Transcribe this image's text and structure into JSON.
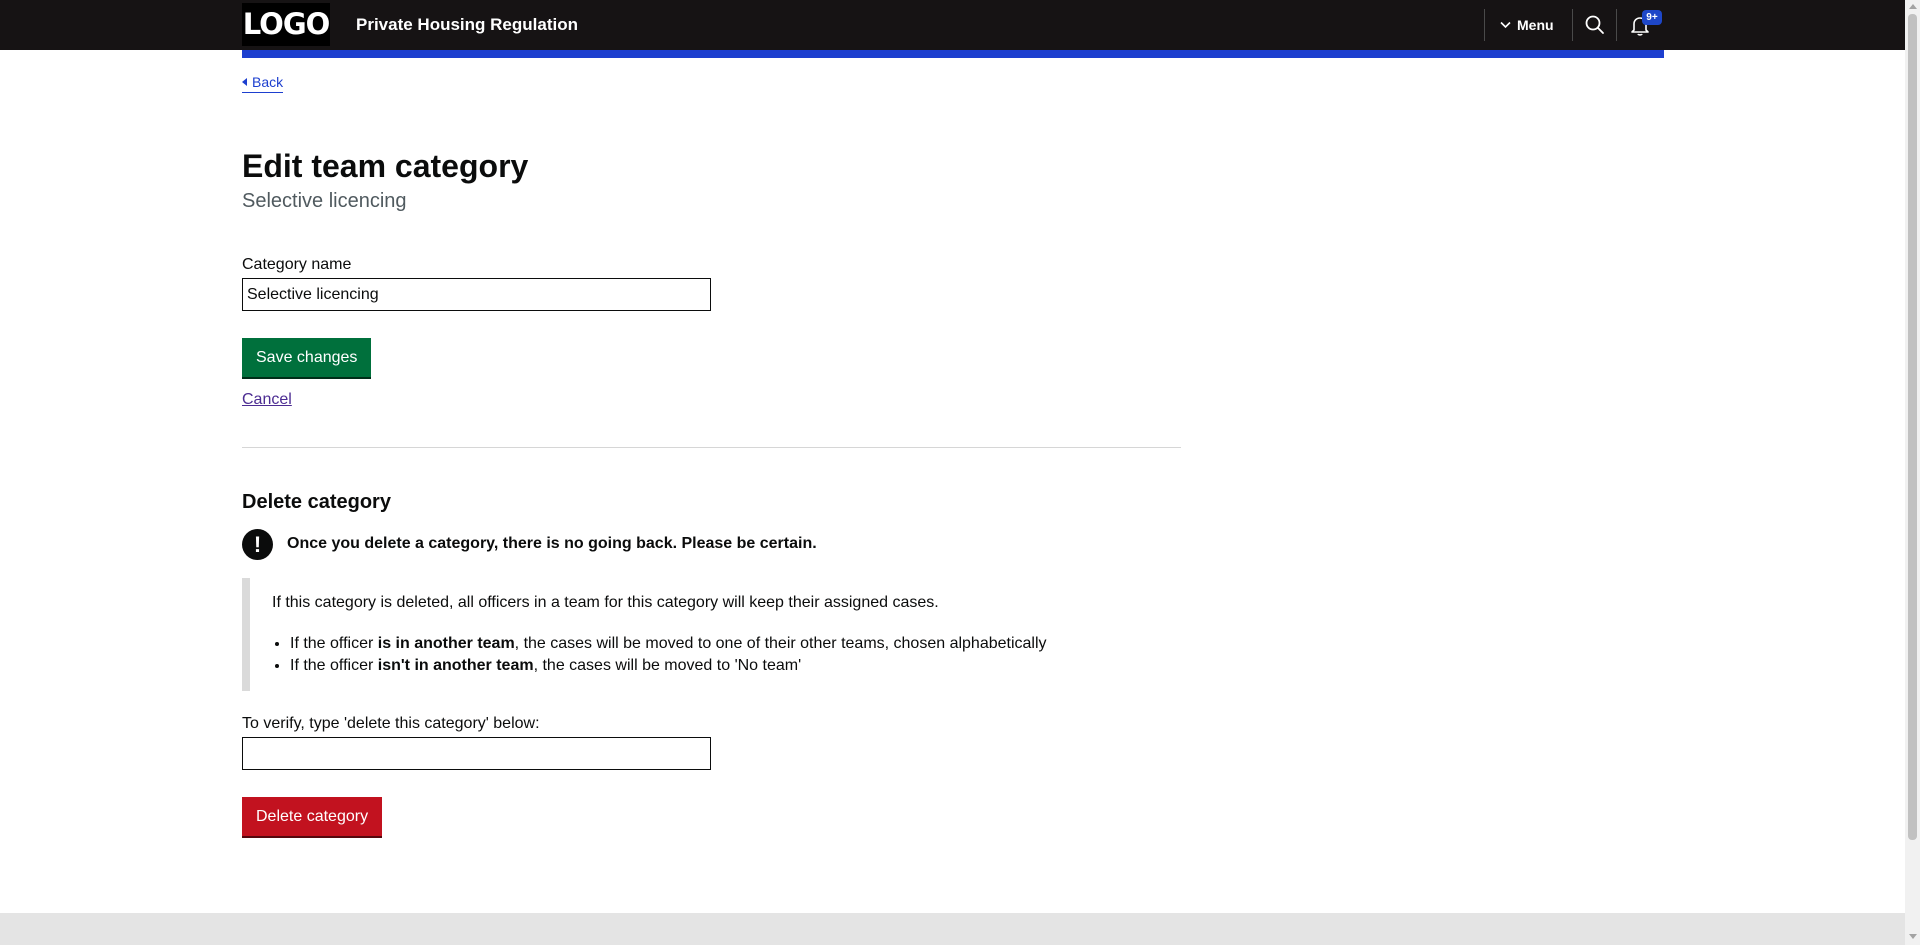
{
  "header": {
    "logo": "LOGO",
    "service_name": "Private Housing Regulation",
    "menu_label": "Menu",
    "menu_icon": "chevron-down-icon",
    "search_icon": "search-icon",
    "notifications_icon": "bell-icon",
    "notification_badge": "9+"
  },
  "nav": {
    "back_label": "Back"
  },
  "page": {
    "title": "Edit team category",
    "caption": "Selective licencing"
  },
  "edit_form": {
    "category_label": "Category name",
    "category_value": "Selective licencing",
    "save_label": "Save changes",
    "cancel_label": "Cancel"
  },
  "delete_section": {
    "heading": "Delete category",
    "warning_text": "Once you delete a category, there is no going back. Please be certain.",
    "inset_intro": "If this category is deleted, all officers in a team for this category will keep their assigned cases.",
    "bullets": [
      {
        "before": "If the officer ",
        "bold": "is in another team",
        "after": ", the cases will be moved to one of their other teams, chosen alphabetically"
      },
      {
        "before": "If the officer ",
        "bold": "isn't in another team",
        "after": ", the cases will be moved to 'No team'"
      }
    ],
    "verify_label": "To verify, type 'delete this category' below:",
    "verify_value": "",
    "delete_label": "Delete category"
  },
  "colors": {
    "header_bg": "#161314",
    "accent_blue": "#1d3fcf",
    "save_green": "#00703c",
    "delete_red": "#c2121f",
    "link_visited": "#4c2c92"
  }
}
